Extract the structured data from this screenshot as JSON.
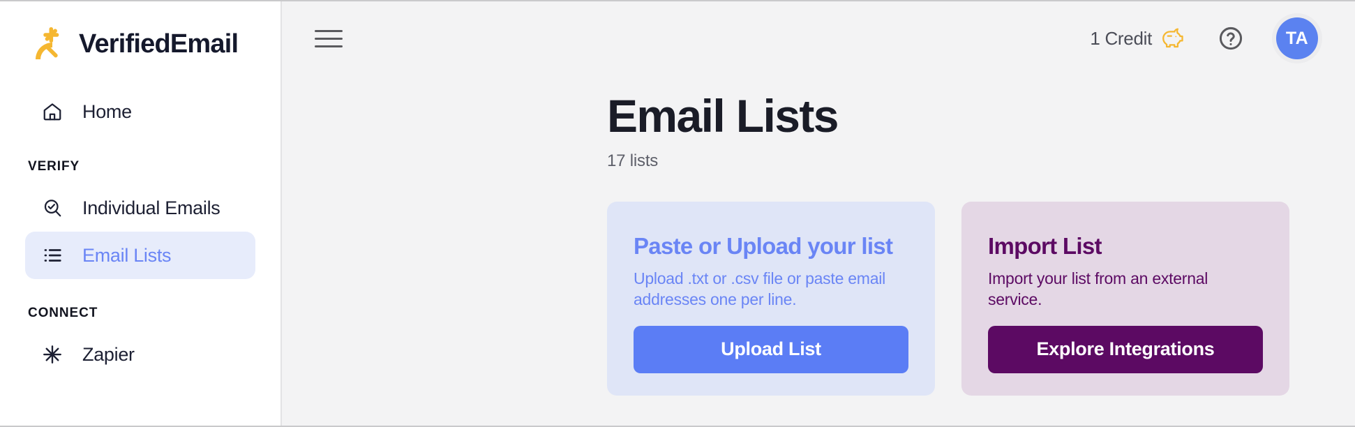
{
  "brand": {
    "name": "VerifiedEmail",
    "logo_icon": "starburst-icon",
    "logo_color": "#f5b731",
    "text_color": "#15192c"
  },
  "sidebar": {
    "items": [
      {
        "label": "Home",
        "icon": "home-icon",
        "active": false
      },
      {
        "label": "Individual Emails",
        "icon": "search-check-icon",
        "active": false
      },
      {
        "label": "Email Lists",
        "icon": "list-icon",
        "active": true
      },
      {
        "label": "Zapier",
        "icon": "zapier-asterisk-icon",
        "active": false
      }
    ],
    "sections": {
      "verify": "VERIFY",
      "connect": "CONNECT"
    },
    "active_bg": "#e7ecfb",
    "active_text": "#6a85f5"
  },
  "topbar": {
    "menu_icon": "hamburger-menu-icon",
    "credits_label": "1 Credit",
    "credits_icon": "piggy-bank-icon",
    "credits_icon_color": "#f5b731",
    "help_icon": "help-circle-icon",
    "avatar_initials": "TA",
    "avatar_color": "#5b82f0"
  },
  "page": {
    "title": "Email Lists",
    "subtitle": "17 lists"
  },
  "cards": [
    {
      "id": "paste-upload",
      "title": "Paste or Upload your list",
      "description": "Upload .txt or .csv file or paste email addresses one per line.",
      "button_label": "Upload List",
      "bg": "#dfe5f7",
      "accent": "#6a85f5",
      "button_bg": "#5b7df5"
    },
    {
      "id": "import-list",
      "title": "Import List",
      "description": "Import your list from an external service.",
      "button_label": "Explore Integrations",
      "bg": "#e4d7e5",
      "accent": "#5c0a63",
      "button_bg": "#5c0a63"
    }
  ],
  "annotation": {
    "arrow_icon": "orange-arrow-pointer",
    "arrow_color": "#f0a51e",
    "cursor_icon": "hand-pointer-cursor"
  }
}
